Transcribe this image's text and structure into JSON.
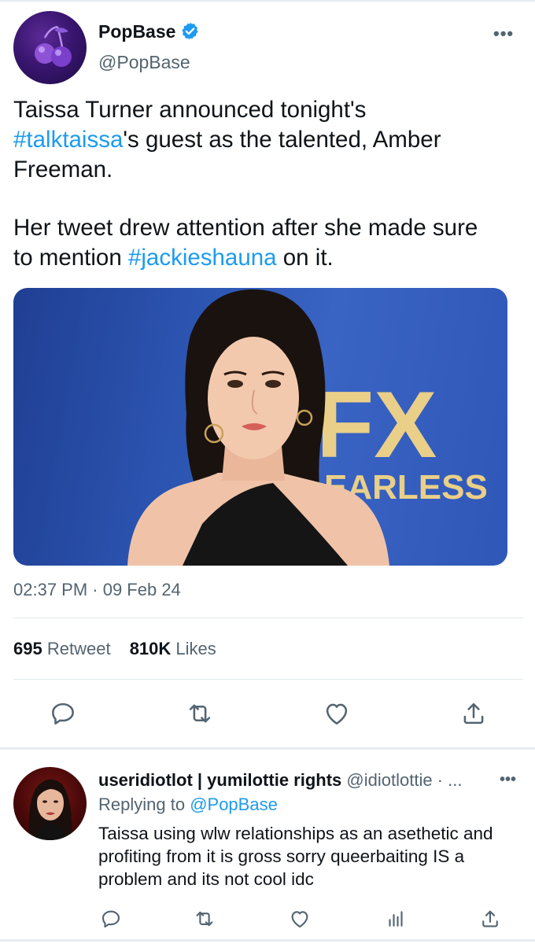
{
  "tweet": {
    "author": {
      "name": "PopBase",
      "handle": "@PopBase",
      "verified": true
    },
    "text": {
      "line1": "Taissa Turner announced tonight's",
      "hashtag1": "#talktaissa",
      "line2_rest": "'s guest as the talented, Amber",
      "line3": "Freeman.",
      "line4": "Her tweet drew attention after she made sure",
      "line5_start": "to mention ",
      "hashtag2": "#jackieshauna",
      "line5_end": " on it."
    },
    "media": {
      "backdrop_logo": "FX",
      "backdrop_text": "EARLESS"
    },
    "timestamp": "02:37 PM · 09 Feb 24",
    "stats": {
      "retweets_count": "695",
      "retweets_label": "Retweet",
      "likes_count": "810K",
      "likes_label": "Likes"
    },
    "more_label": "•••"
  },
  "reply": {
    "author_name": "useridiotlot | yumilottie rights",
    "handle_time": "@idiotlottie · ...",
    "more_label": "•••",
    "replying_prefix": "Replying to ",
    "replying_to": "@PopBase",
    "text": "Taissa using wlw relationships as an asethetic and profiting from it is gross sorry queerbaiting IS a problem and its not cool idc"
  },
  "icons": {
    "reply": "reply-icon",
    "retweet": "retweet-icon",
    "like": "heart-icon",
    "share": "share-icon",
    "analytics": "analytics-icon",
    "verified": "verified-badge-icon"
  },
  "colors": {
    "accent": "#1d9bf0",
    "secondary_text": "#536471",
    "primary_text": "#0f1419"
  }
}
